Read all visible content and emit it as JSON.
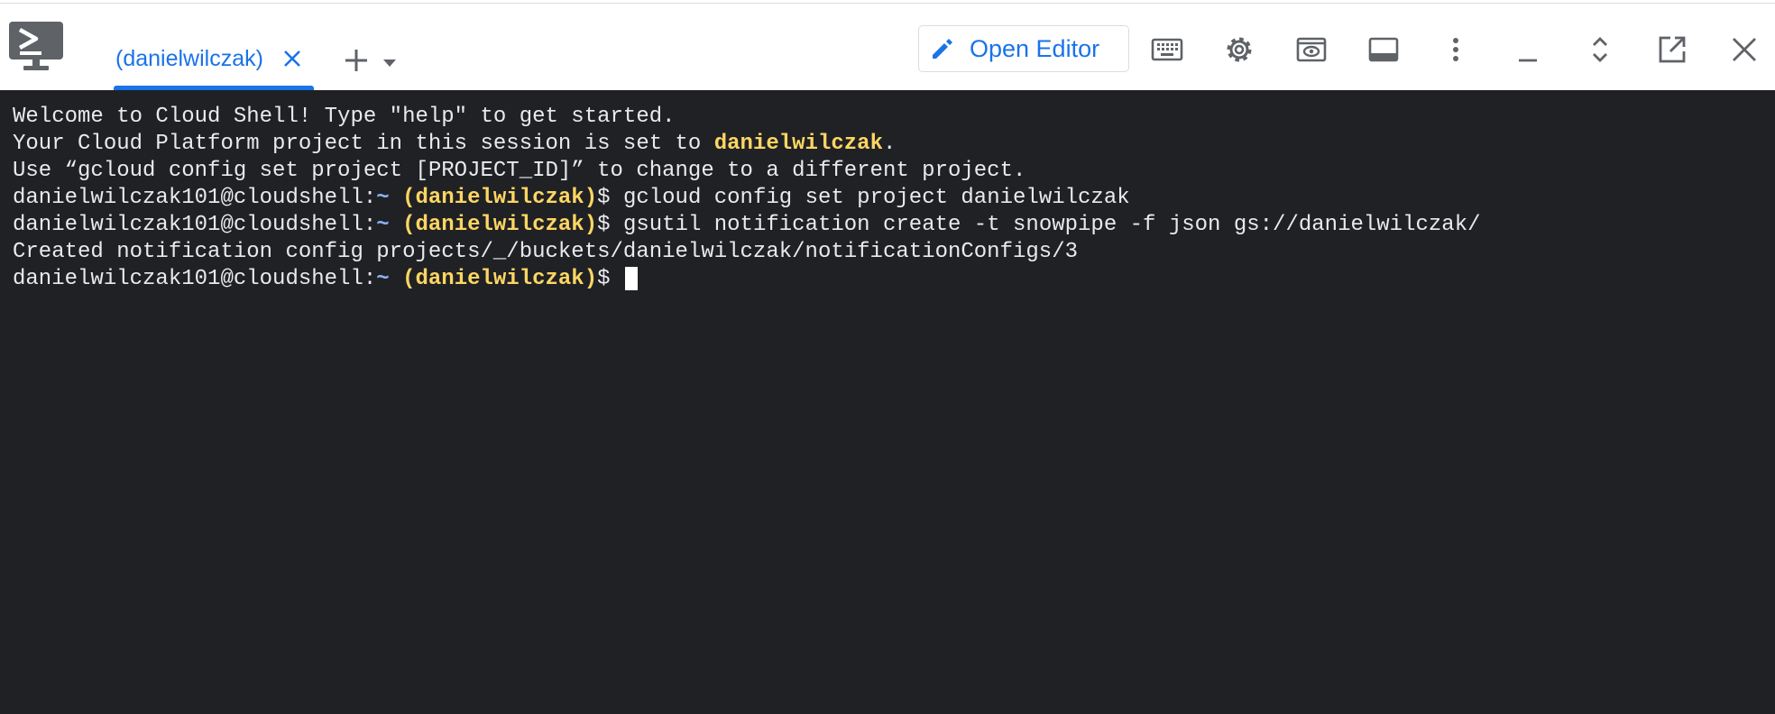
{
  "tab": {
    "label": "(danielwilczak)"
  },
  "toolbar": {
    "open_editor_label": "Open Editor",
    "icons": [
      "keyboard-icon",
      "gear-icon",
      "web-preview-icon",
      "panel-layout-icon",
      "more-vert-icon",
      "minimize-icon",
      "restore-icon",
      "open-new-window-icon",
      "close-icon"
    ]
  },
  "colors": {
    "accent": "#1a73e8",
    "terminal_bg": "#202124",
    "prompt_project": "#fdd663",
    "prompt_tilde": "#8ab4f8"
  },
  "terminal": {
    "welcome": "Welcome to Cloud Shell! Type \"help\" to get started.",
    "project_prefix": "Your Cloud Platform project in this session is set to ",
    "project_name": "danielwilczak",
    "project_suffix": ".",
    "hint": "Use “gcloud config set project [PROJECT_ID]” to change to a different project.",
    "prompt_host": "danielwilczak101@cloudshell:",
    "prompt_tilde": "~",
    "prompt_project": "(danielwilczak)",
    "prompt_dollar": "$ ",
    "cmd1": "gcloud config set project danielwilczak",
    "cmd2": "gsutil notification create -t snowpipe -f json gs://danielwilczak/",
    "output1": "Created notification config projects/_/buckets/danielwilczak/notificationConfigs/3"
  }
}
